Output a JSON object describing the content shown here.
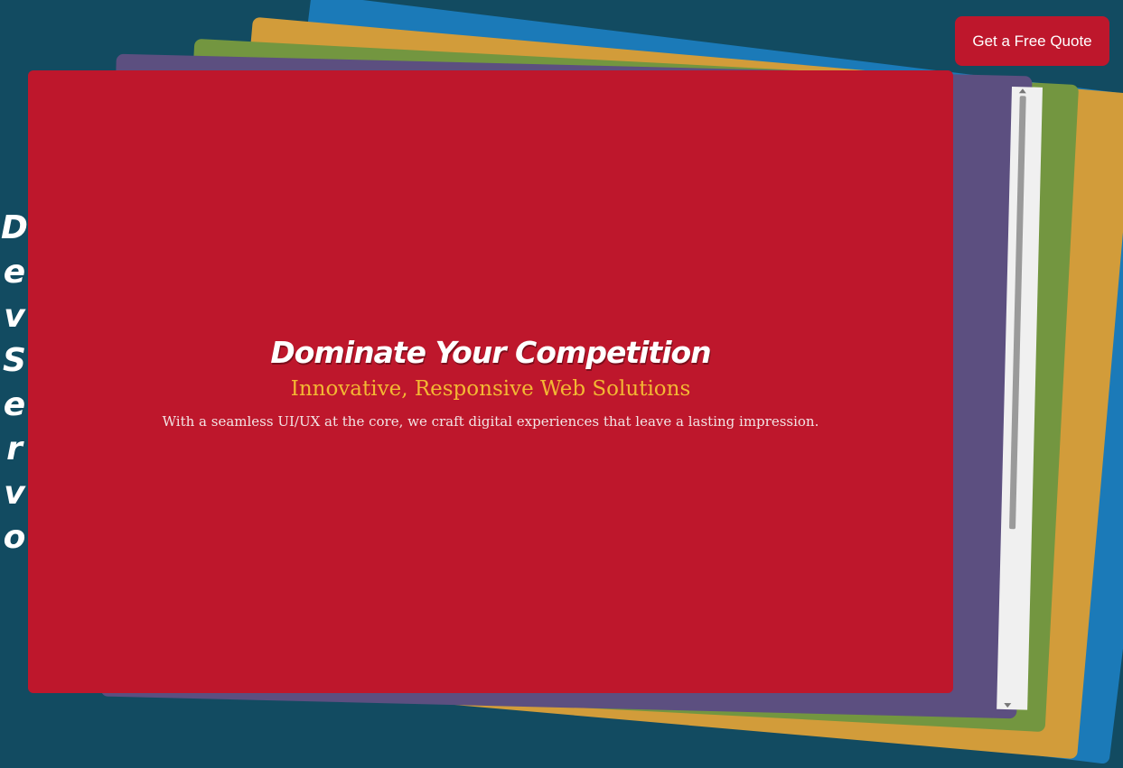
{
  "brand": {
    "name": "DevServo",
    "letters": [
      "D",
      "e",
      "v",
      "S",
      "e",
      "r",
      "v",
      "o"
    ]
  },
  "header": {
    "cta_label": "Get a Free Quote"
  },
  "hero": {
    "title": "Dominate Your Competition",
    "subtitle": "Innovative, Responsive Web Solutions",
    "description": "With a seamless UI/UX at the core, we craft digital experiences that leave a lasting impression."
  },
  "colors": {
    "background": "#124b61",
    "card_front": "#be172c",
    "card_purple": "#5c4f80",
    "card_green": "#739640",
    "card_orange": "#d29c3a",
    "card_blue": "#1b7ab8",
    "cta_button": "#be172c",
    "subtitle_text": "#f3b833",
    "description_text": "#f2e4e4"
  }
}
